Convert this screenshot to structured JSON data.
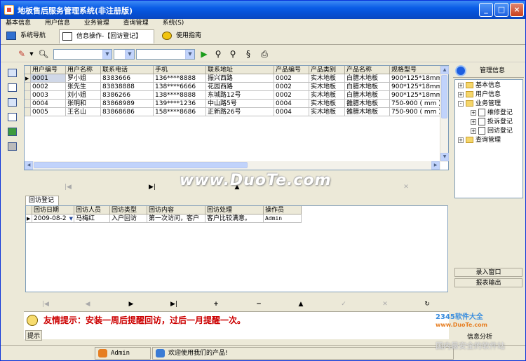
{
  "window": {
    "title": "地板售后服务管理系统(非注册版)"
  },
  "menu": [
    "基本信息",
    "用户信息",
    "业务管理",
    "查询管理",
    "系统(S)"
  ],
  "tabs": [
    {
      "label": "系统导航"
    },
    {
      "label": "信息操作-【回访登记】"
    },
    {
      "label": "使用指南"
    }
  ],
  "table1": {
    "columns": [
      "用户编号",
      "用户名称",
      "联系电话",
      "手机",
      "联系地址",
      "产品编号",
      "产品类别",
      "产品名称",
      "规格型号"
    ],
    "rows": [
      [
        "0001",
        "罗小姐",
        "8383666",
        "136****8888",
        "振兴西路",
        "0002",
        "实木地板",
        "白腊木地板",
        "900*125*18mm"
      ],
      [
        "0002",
        "张先生",
        "83838888",
        "138****6666",
        "花园西路",
        "0002",
        "实木地板",
        "白腊木地板",
        "900*125*18mm"
      ],
      [
        "0003",
        "刘小姐",
        "8386266",
        "138****8888",
        "东城路12号",
        "0002",
        "实木地板",
        "白腊木地板",
        "900*125*18mm"
      ],
      [
        "0004",
        "张明和",
        "83868989",
        "139****1236",
        "中山路5号",
        "0004",
        "实木地板",
        "雒腊木地板",
        "750-900 ( mm )"
      ],
      [
        "0005",
        "王名山",
        "83868686",
        "158****8686",
        "正新路26号",
        "0004",
        "实木地板",
        "雒腊木地板",
        "750-900 ( mm )"
      ]
    ]
  },
  "subtab": "回访登记",
  "table2": {
    "columns": [
      "回访日期",
      "回访人员",
      "回访类型",
      "回访内容",
      "回访处理",
      "操作员"
    ],
    "rows": [
      [
        "2009-08-2",
        "马梅红",
        "入户回访",
        "第一次访问，客户",
        "客户比较满意。",
        "Admin"
      ]
    ]
  },
  "tip": {
    "text": "友情提示：安装一周后提醒回访，过后一月提醒一次。",
    "label": "提示"
  },
  "right_panel": {
    "title": "管理信息",
    "tree": [
      {
        "label": "基本信息",
        "level": 0,
        "sign": "+"
      },
      {
        "label": "用户信息",
        "level": 0,
        "sign": "+"
      },
      {
        "label": "业务管理",
        "level": 0,
        "sign": "-"
      },
      {
        "label": "维修登记",
        "level": 1,
        "sign": "+"
      },
      {
        "label": "投诉登记",
        "level": 1,
        "sign": "+"
      },
      {
        "label": "回访登记",
        "level": 1,
        "sign": "+"
      },
      {
        "label": "查询管理",
        "level": 0,
        "sign": "+"
      }
    ],
    "buttons": [
      "录入窗口",
      "报表输出"
    ],
    "bottom_label": "信息分析"
  },
  "status": {
    "user": "Admin",
    "welcome": "欢迎使用我们的产品!"
  },
  "watermarks": {
    "main": "www.DuoTe.com",
    "corner": "2345软件大全",
    "corner2": "www.DuoTe.com",
    "bottom": "国内最安全的软件站"
  },
  "colors": {
    "title": "#0a5ce6",
    "tip": "#cc0000"
  }
}
